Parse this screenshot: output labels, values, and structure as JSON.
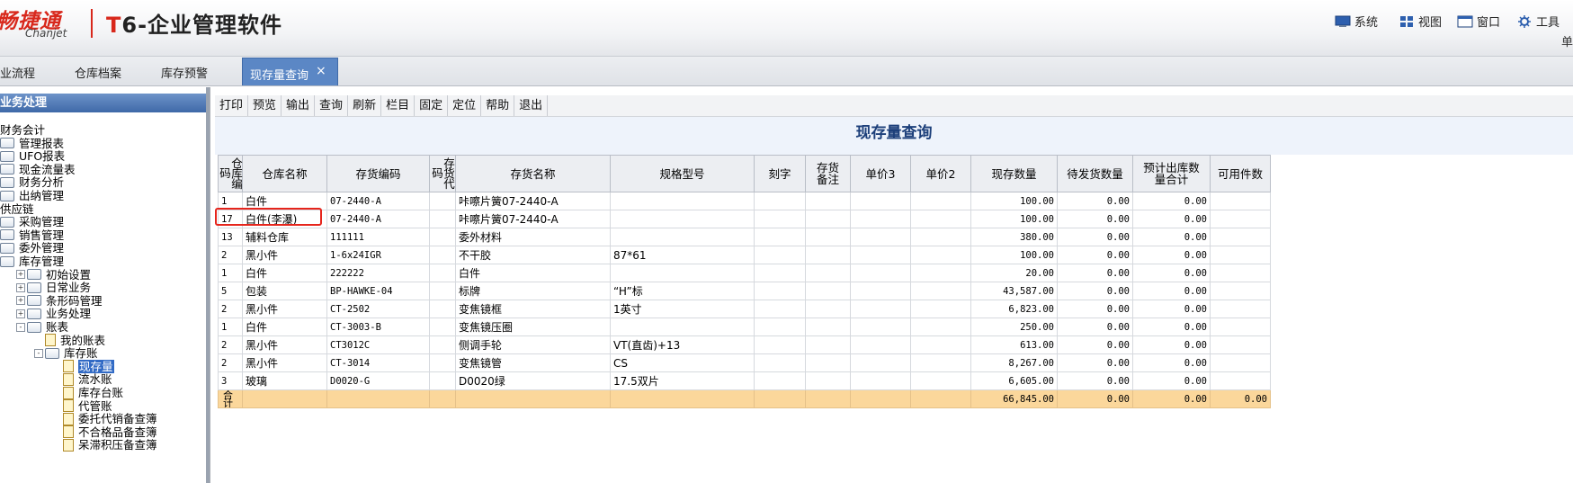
{
  "header": {
    "logo_cn": "畅捷通",
    "logo_en": "Chanjet",
    "app_title_t": "T",
    "app_title_rest": "6-企业管理软件",
    "menu": [
      {
        "label": "系统",
        "icon": "system-icon"
      },
      {
        "label": "视图",
        "icon": "view-icon"
      },
      {
        "label": "窗口",
        "icon": "window-icon"
      },
      {
        "label": "工具",
        "icon": "tools-icon"
      }
    ],
    "right_char": "单"
  },
  "tabs": [
    {
      "label": "业流程"
    },
    {
      "label": "仓库档案"
    },
    {
      "label": "库存预警"
    },
    {
      "label": "现存量查询",
      "active": true,
      "close": "×"
    }
  ],
  "sidebar": {
    "title": "业务处理",
    "tree": [
      {
        "label": "财务会计",
        "level": 0,
        "type": "root"
      },
      {
        "label": "管理报表",
        "level": 1,
        "type": "folder"
      },
      {
        "label": "UFO报表",
        "level": 1,
        "type": "folder"
      },
      {
        "label": "现金流量表",
        "level": 1,
        "type": "folder"
      },
      {
        "label": "财务分析",
        "level": 1,
        "type": "folder"
      },
      {
        "label": "出纳管理",
        "level": 1,
        "type": "folder"
      },
      {
        "label": "供应链",
        "level": 0,
        "type": "root"
      },
      {
        "label": "采购管理",
        "level": 1,
        "type": "folder"
      },
      {
        "label": "销售管理",
        "level": 1,
        "type": "folder"
      },
      {
        "label": "委外管理",
        "level": 1,
        "type": "folder"
      },
      {
        "label": "库存管理",
        "level": 1,
        "type": "folder"
      },
      {
        "label": "初始设置",
        "level": 2,
        "type": "folder",
        "expander": "+"
      },
      {
        "label": "日常业务",
        "level": 2,
        "type": "folder",
        "expander": "+"
      },
      {
        "label": "条形码管理",
        "level": 2,
        "type": "folder",
        "expander": "+"
      },
      {
        "label": "业务处理",
        "level": 2,
        "type": "folder",
        "expander": "+"
      },
      {
        "label": "账表",
        "level": 2,
        "type": "folder",
        "expander": "-"
      },
      {
        "label": "我的账表",
        "level": 3,
        "type": "doc"
      },
      {
        "label": "库存账",
        "level": 3,
        "type": "folder",
        "expander": "-"
      },
      {
        "label": "现存量",
        "level": 4,
        "type": "doc",
        "selected": true
      },
      {
        "label": "流水账",
        "level": 4,
        "type": "doc"
      },
      {
        "label": "库存台账",
        "level": 4,
        "type": "doc"
      },
      {
        "label": "代管账",
        "level": 4,
        "type": "doc"
      },
      {
        "label": "委托代销备查簿",
        "level": 4,
        "type": "doc"
      },
      {
        "label": "不合格品备查簿",
        "level": 4,
        "type": "doc"
      },
      {
        "label": "呆滞积压备查簿",
        "level": 4,
        "type": "doc"
      }
    ]
  },
  "toolbar": [
    "打印",
    "预览",
    "输出",
    "查询",
    "刷新",
    "栏目",
    "固定",
    "定位",
    "帮助",
    "退出"
  ],
  "report": {
    "title": "现存量查询",
    "columns": [
      "仓库编码",
      "仓库名称",
      "存货编码",
      "存货代码",
      "存货名称",
      "规格型号",
      "刻字",
      "存货备注",
      "单价3",
      "单价2",
      "现存数量",
      "待发货数量",
      "预计出库数量合计",
      "可用件数"
    ],
    "rows": [
      [
        "1",
        "白件",
        "07-2440-A",
        "",
        "咔嚓片簧07-2440-A",
        "",
        "",
        "",
        "",
        "",
        "100.00",
        "0.00",
        "0.00",
        ""
      ],
      [
        "17",
        "白件(李瀑)",
        "07-2440-A",
        "",
        "咔嚓片簧07-2440-A",
        "",
        "",
        "",
        "",
        "",
        "100.00",
        "0.00",
        "0.00",
        ""
      ],
      [
        "13",
        "辅料仓库",
        "111111",
        "",
        "委外材料",
        "",
        "",
        "",
        "",
        "",
        "380.00",
        "0.00",
        "0.00",
        ""
      ],
      [
        "2",
        "黑小件",
        "1-6x24IGR",
        "",
        "不干胶",
        "87*61",
        "",
        "",
        "",
        "",
        "100.00",
        "0.00",
        "0.00",
        ""
      ],
      [
        "1",
        "白件",
        "222222",
        "",
        "白件",
        "",
        "",
        "",
        "",
        "",
        "20.00",
        "0.00",
        "0.00",
        ""
      ],
      [
        "5",
        "包装",
        "BP-HAWKE-04",
        "",
        "标牌",
        "“H”标",
        "",
        "",
        "",
        "",
        "43,587.00",
        "0.00",
        "0.00",
        ""
      ],
      [
        "2",
        "黑小件",
        "CT-2502",
        "",
        "变焦镜框",
        "1英寸",
        "",
        "",
        "",
        "",
        "6,823.00",
        "0.00",
        "0.00",
        ""
      ],
      [
        "1",
        "白件",
        "CT-3003-B",
        "",
        "变焦镜压圈",
        "",
        "",
        "",
        "",
        "",
        "250.00",
        "0.00",
        "0.00",
        ""
      ],
      [
        "2",
        "黑小件",
        "CT3012C",
        "",
        "侧调手轮",
        "VT(直齿)+13",
        "",
        "",
        "",
        "",
        "613.00",
        "0.00",
        "0.00",
        ""
      ],
      [
        "2",
        "黑小件",
        "CT-3014",
        "",
        "变焦镜管",
        "CS",
        "",
        "",
        "",
        "",
        "8,267.00",
        "0.00",
        "0.00",
        ""
      ],
      [
        "3",
        "玻璃",
        "D0020-G",
        "",
        "D0020绿",
        "17.5双片",
        "",
        "",
        "",
        "",
        "6,605.00",
        "0.00",
        "0.00",
        ""
      ]
    ],
    "total": [
      "合计",
      "",
      "",
      "",
      "",
      "",
      "",
      "",
      "",
      "",
      "66,845.00",
      "0.00",
      "0.00",
      "0.00"
    ]
  },
  "colors": {
    "brand_red": "#d8281c",
    "tab_active": "#5b87c5",
    "sidebar_header": "#4a74b3",
    "total_row": "#fbd79b",
    "highlight_border": "#e6251c"
  }
}
